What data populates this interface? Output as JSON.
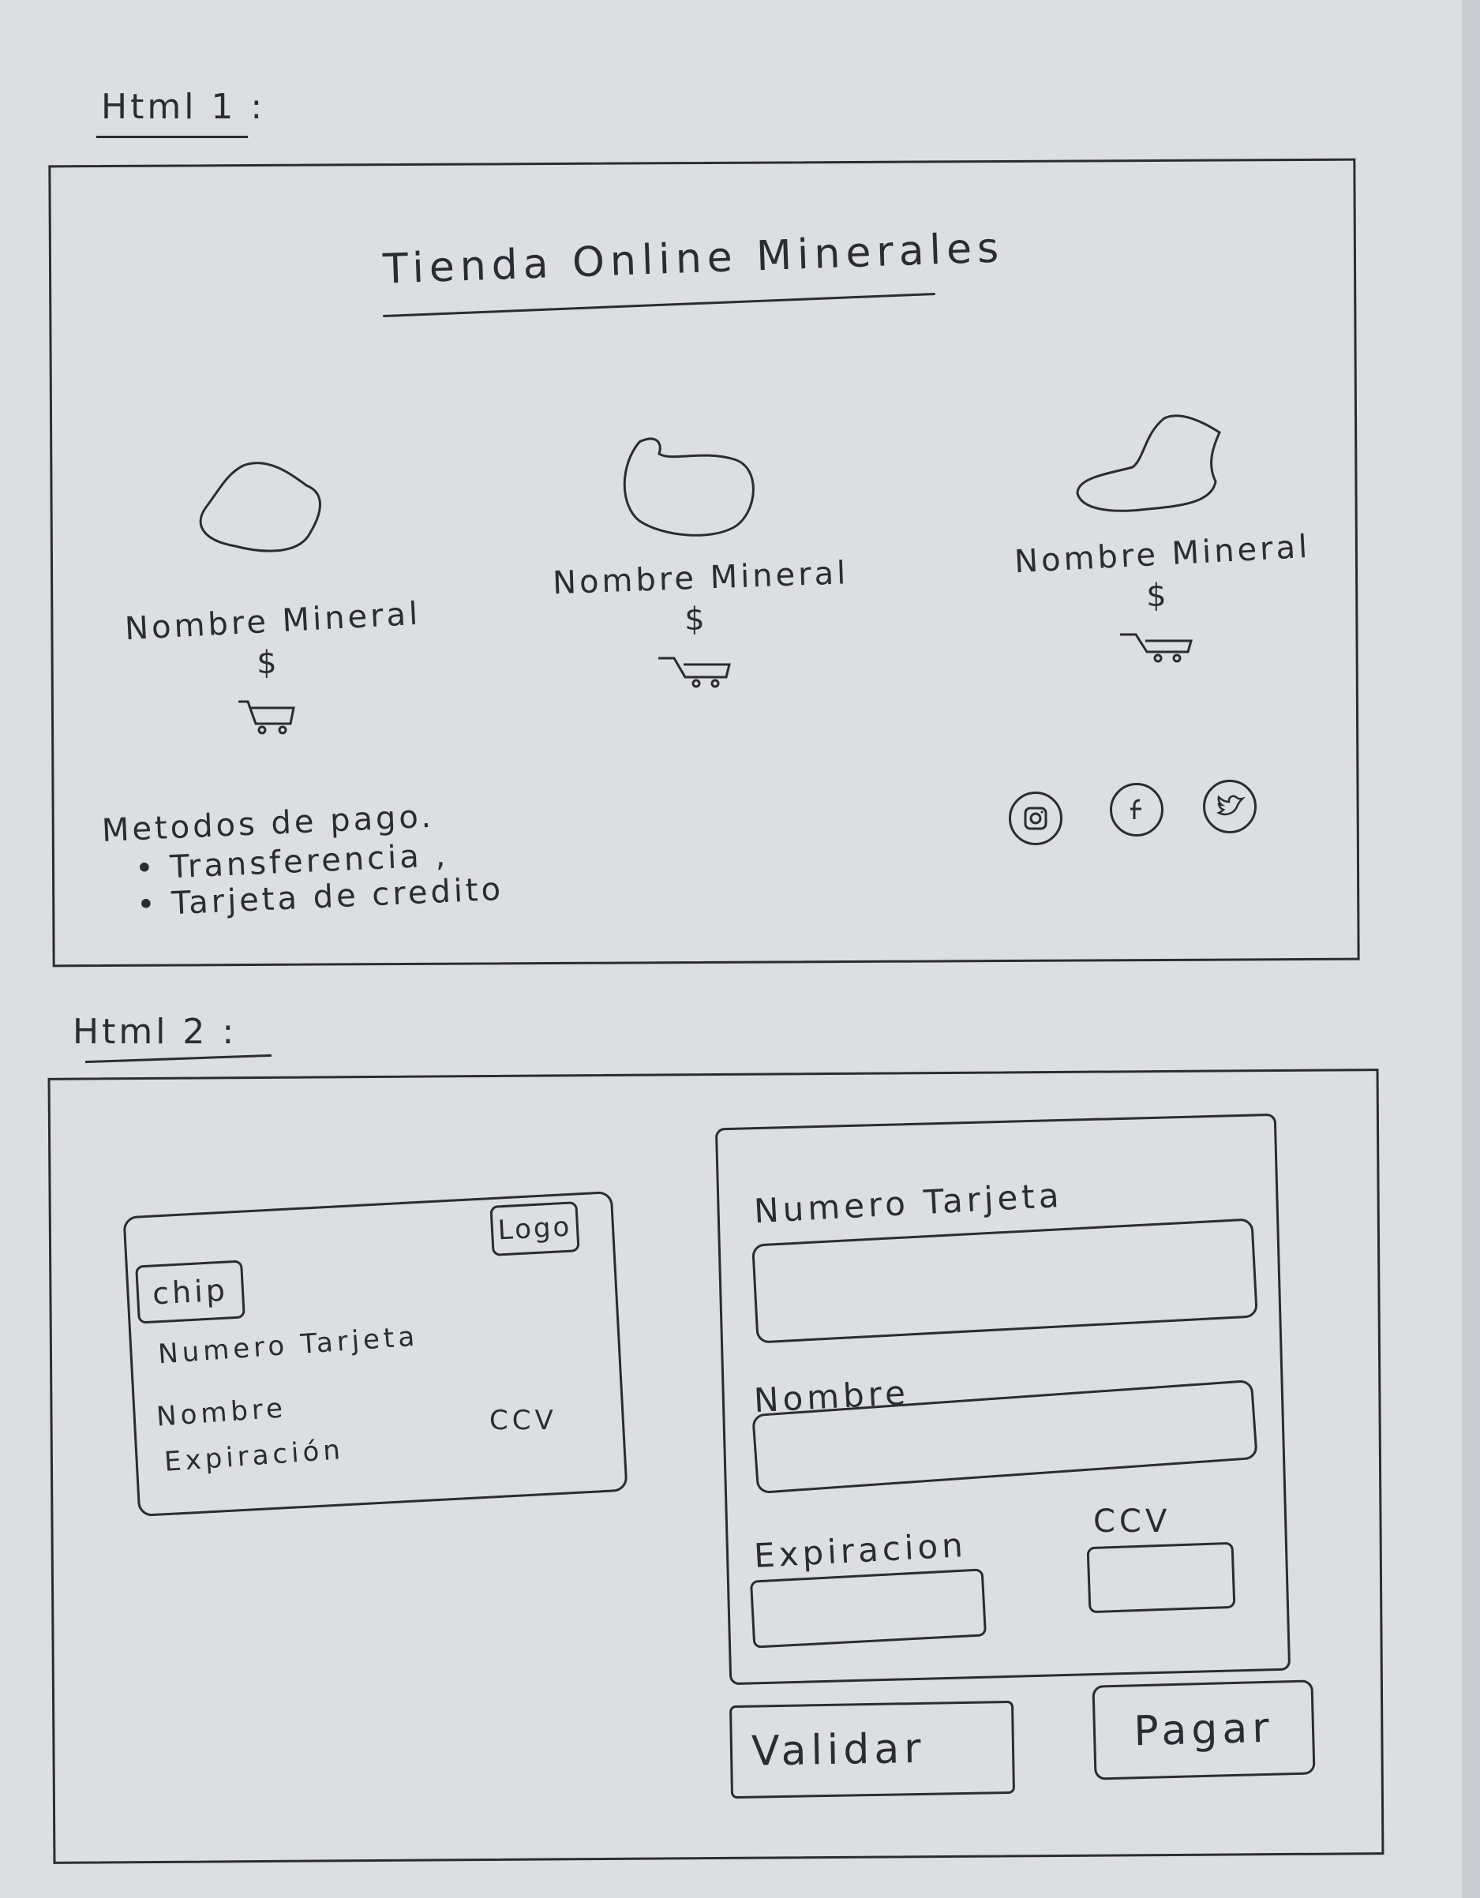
{
  "section1": {
    "heading": "Html 1 :",
    "store_title": "Tienda Online Minerales",
    "products": [
      {
        "name": "Nombre Mineral",
        "price": "$",
        "cart_icon": "cart-icon",
        "image_icon": "mineral-rock-icon"
      },
      {
        "name": "Nombre Mineral",
        "price": "$",
        "cart_icon": "cart-icon",
        "image_icon": "mineral-rock-icon"
      },
      {
        "name": "Nombre Mineral",
        "price": "$",
        "cart_icon": "cart-icon",
        "image_icon": "mineral-rock-icon"
      }
    ],
    "payment_title": "Metodos de pago.",
    "payment_methods": [
      "Transferencia ,",
      "Tarjeta de credito"
    ],
    "social_icons": [
      "instagram-icon",
      "facebook-icon",
      "twitter-icon"
    ]
  },
  "section2": {
    "heading": "Html 2 :",
    "card_preview": {
      "logo": "Logo",
      "chip": "chip",
      "number": "Numero Tarjeta",
      "name": "Nombre",
      "expiration": "Expiración",
      "ccv": "CCV"
    },
    "form": {
      "number_label": "Numero Tarjeta",
      "name_label": "Nombre",
      "expiration_label": "Expiracion",
      "ccv_label": "CCV"
    },
    "buttons": {
      "validate": "Validar",
      "pay": "Pagar"
    }
  }
}
